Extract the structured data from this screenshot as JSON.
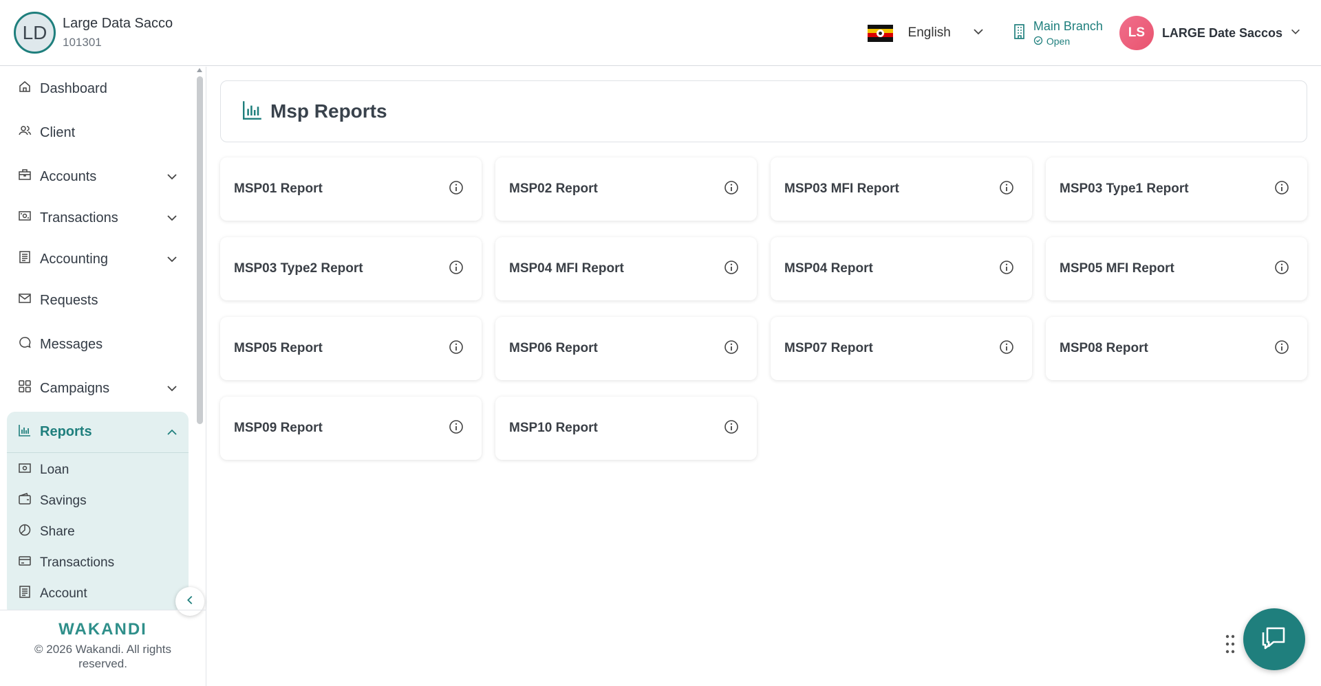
{
  "header": {
    "org_initials": "LD",
    "org_name": "Large Data Sacco",
    "org_code": "101301",
    "language": "English",
    "branch_name": "Main Branch",
    "branch_status": "Open",
    "user_initials": "LS",
    "user_name": "LARGE Date Saccos"
  },
  "sidebar": {
    "items": [
      {
        "label": "Dashboard",
        "icon": "home-icon"
      },
      {
        "label": "Client",
        "icon": "users-icon"
      },
      {
        "label": "Accounts",
        "icon": "briefcase-icon"
      },
      {
        "label": "Transactions",
        "icon": "cash-icon"
      },
      {
        "label": "Accounting",
        "icon": "ledger-icon"
      },
      {
        "label": "Requests",
        "icon": "mail-icon"
      },
      {
        "label": "Messages",
        "icon": "chat-icon"
      },
      {
        "label": "Campaigns",
        "icon": "grid-icon"
      }
    ],
    "reports": {
      "label": "Reports",
      "sub_items": [
        {
          "label": "Loan",
          "icon": "cash-icon"
        },
        {
          "label": "Savings",
          "icon": "wallet-icon"
        },
        {
          "label": "Share",
          "icon": "pie-icon"
        },
        {
          "label": "Transactions",
          "icon": "card-icon"
        },
        {
          "label": "Account",
          "icon": "ledger-icon"
        }
      ]
    },
    "brand": "WAKANDI",
    "copyright": "© 2026 Wakandi. All rights reserved."
  },
  "main": {
    "title": "Msp Reports",
    "reports": [
      "MSP01 Report",
      "MSP02 Report",
      "MSP03 MFI Report",
      "MSP03 Type1 Report",
      "MSP03 Type2 Report",
      "MSP04 MFI Report",
      "MSP04 Report",
      "MSP05 MFI Report",
      "MSP05 Report",
      "MSP06 Report",
      "MSP07 Report",
      "MSP08 Report",
      "MSP09 Report",
      "MSP10 Report"
    ]
  },
  "colors": {
    "accent": "#1f7f7d",
    "reports_bg": "#e3f0f0",
    "user_avatar": "#e9546f"
  }
}
